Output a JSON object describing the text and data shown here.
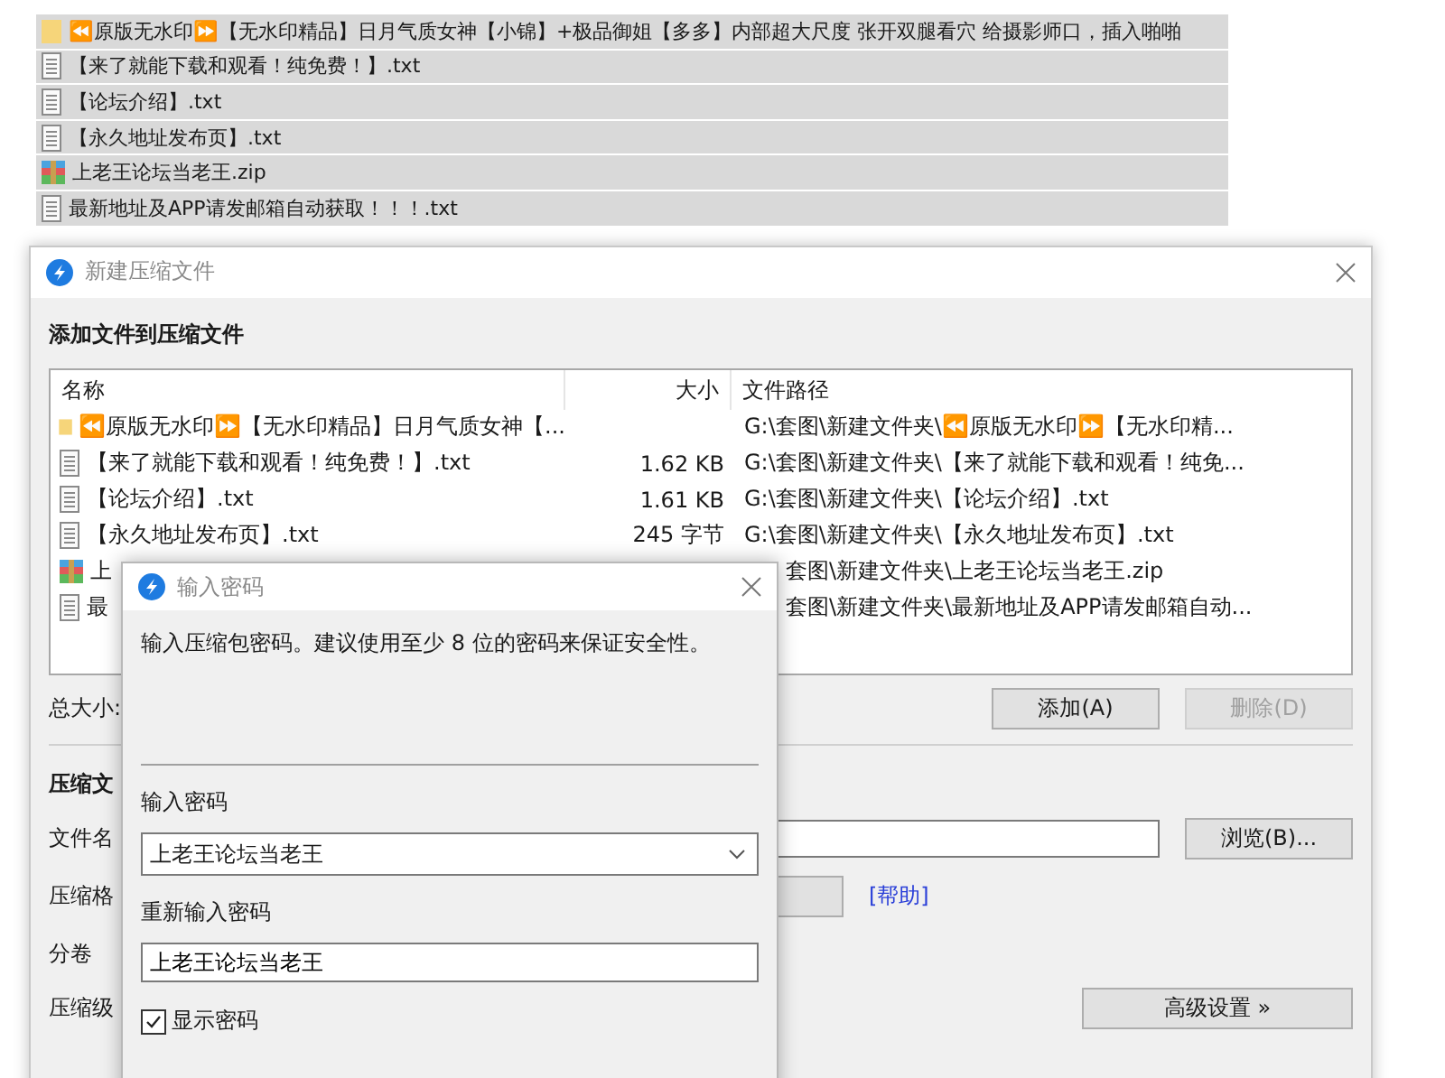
{
  "file_list": [
    {
      "kind": "folder",
      "name": "⏪原版无水印⏩【无水印精品】日月气质女神【小锦】+极品御姐【多多】内部超大尺度 张开双腿看穴 给摄影师口，插入啪啪"
    },
    {
      "kind": "text",
      "name": "【来了就能下载和观看！纯免费！】.txt"
    },
    {
      "kind": "text",
      "name": "【论坛介绍】.txt"
    },
    {
      "kind": "text",
      "name": "【永久地址发布页】.txt"
    },
    {
      "kind": "zip",
      "name": "上老王论坛当老王.zip"
    },
    {
      "kind": "text",
      "name": "最新地址及APP请发邮箱自动获取！！！.txt"
    }
  ],
  "archive_dialog": {
    "title": "新建压缩文件",
    "section_title": "添加文件到压缩文件",
    "columns": [
      "名称",
      "大小",
      "文件路径"
    ],
    "rows": [
      {
        "kind": "folder",
        "name": "⏪原版无水印⏩【无水印精品】日月气质女神【...",
        "path": "G:\\套图\\新建文件夹\\⏪原版无水印⏩【无水印精..."
      },
      {
        "kind": "text",
        "name": "【来了就能下载和观看！纯免费！】.txt",
        "size": "1.62 KB",
        "path": "G:\\套图\\新建文件夹\\【来了就能下载和观看！纯免..."
      },
      {
        "kind": "text",
        "name": "【论坛介绍】.txt",
        "size": "1.61 KB",
        "path": "G:\\套图\\新建文件夹\\【论坛介绍】.txt"
      },
      {
        "kind": "text",
        "name": "【永久地址发布页】.txt",
        "size": "245 字节",
        "path": "G:\\套图\\新建文件夹\\【永久地址发布页】.txt"
      },
      {
        "kind": "zip",
        "name": "上",
        "path": "套图\\新建文件夹\\上老王论坛当老王.zip"
      },
      {
        "kind": "text",
        "name": "最",
        "path": "套图\\新建文件夹\\最新地址及APP请发邮箱自动..."
      }
    ],
    "total_label": "总大小:",
    "list_buttons": [
      {
        "label": "添加(A)",
        "disabled": false
      },
      {
        "label": "删除(D)",
        "disabled": true
      }
    ],
    "archive_section_title": "压缩文",
    "filename_label": "文件名",
    "browse_button": "浏览(B)...",
    "format_label": "压缩格",
    "help_link": "[帮助]",
    "volume_label": "分卷",
    "level_label": "压缩级",
    "advanced_button": "高级设置 »"
  },
  "password_dialog": {
    "title": "输入密码",
    "description": "输入压缩包密码。建议使用至少 8 位的密码来保证安全性。",
    "password_label": "输入密码",
    "password": "上老王论坛当老王",
    "confirm_label": "重新输入密码",
    "confirm_password": "上老王论坛当老王",
    "show_password": {
      "label": "显示密码",
      "checked": true
    }
  }
}
